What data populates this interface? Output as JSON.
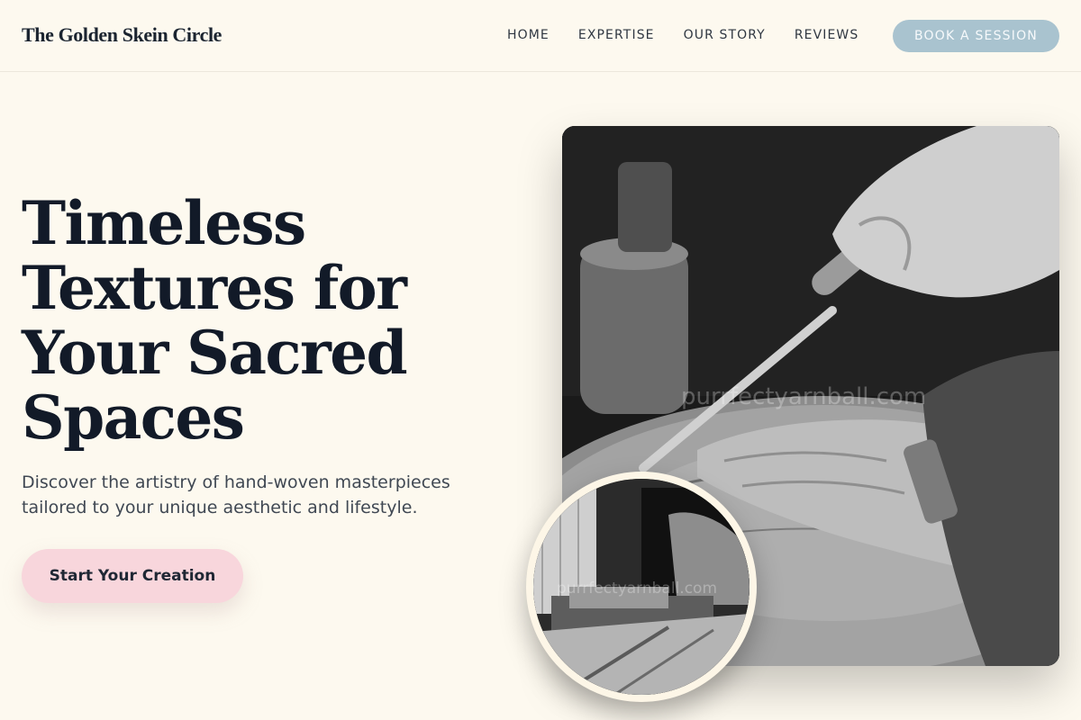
{
  "header": {
    "brand": "The Golden Skein Circle",
    "nav": [
      {
        "label": "HOME"
      },
      {
        "label": "EXPERTISE"
      },
      {
        "label": "OUR STORY"
      },
      {
        "label": "REVIEWS"
      }
    ],
    "cta_label": "BOOK A SESSION"
  },
  "hero": {
    "title": "Timeless Textures for Your Sacred Spaces",
    "subtitle": "Discover the artistry of hand-woven masterpieces tailored to your unique aesthetic and lifestyle.",
    "cta_label": "Start Your Creation"
  },
  "images": {
    "main_watermark": "purrfectyarnball.com",
    "inset_watermark": "purrfectyarnball.com"
  },
  "colors": {
    "background": "#fdf9ef",
    "book_button": "#a9c3cf",
    "cta_button": "#f8d6dc",
    "heading": "#121a28"
  }
}
